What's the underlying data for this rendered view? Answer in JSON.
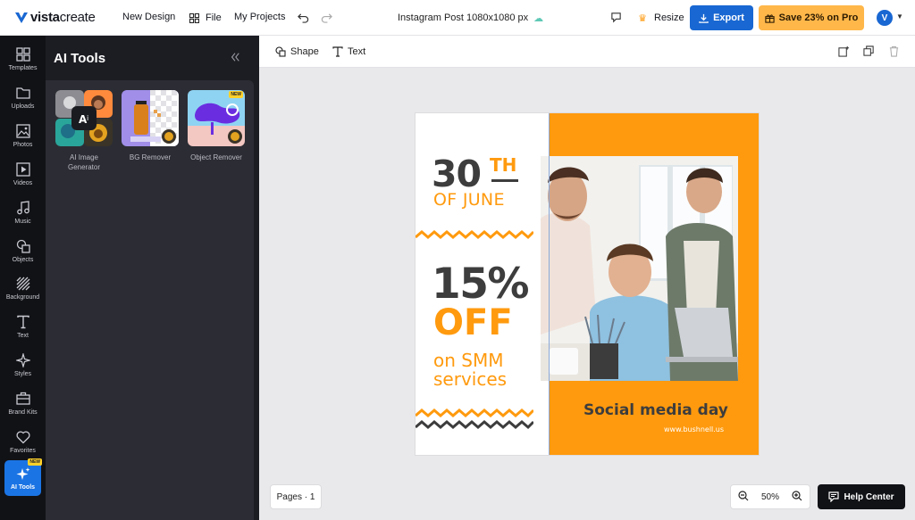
{
  "topbar": {
    "logo_bold": "vista",
    "logo_light": "create",
    "new_design": "New Design",
    "file": "File",
    "my_projects": "My Projects",
    "doc_title": "Instagram Post 1080x1080 px",
    "resize": "Resize",
    "export": "Export",
    "save_pro": "Save 23% on Pro",
    "avatar_initial": "V"
  },
  "rail": {
    "items": [
      {
        "label": "Templates",
        "icon": "templates-icon"
      },
      {
        "label": "Uploads",
        "icon": "folder-icon"
      },
      {
        "label": "Photos",
        "icon": "image-icon"
      },
      {
        "label": "Videos",
        "icon": "play-icon"
      },
      {
        "label": "Music",
        "icon": "music-note-icon"
      },
      {
        "label": "Objects",
        "icon": "shapes-icon"
      },
      {
        "label": "Background",
        "icon": "stripes-icon"
      },
      {
        "label": "Text",
        "icon": "text-t-icon"
      },
      {
        "label": "Styles",
        "icon": "sparkle-icon"
      },
      {
        "label": "Brand Kits",
        "icon": "briefcase-icon"
      },
      {
        "label": "Favorites",
        "icon": "heart-icon"
      },
      {
        "label": "AI Tools",
        "icon": "ai-sparkle-icon",
        "badge": "NEW"
      }
    ]
  },
  "panel": {
    "title": "AI Tools",
    "tools": [
      {
        "label_line1": "AI Image",
        "label_line2": "Generator"
      },
      {
        "label_line1": "BG Remover",
        "label_line2": ""
      },
      {
        "label_line1": "Object Remover",
        "label_line2": "",
        "badge": "NEW"
      }
    ]
  },
  "subbar": {
    "shape": "Shape",
    "text": "Text"
  },
  "design": {
    "day": "30",
    "suffix": "TH",
    "month": "OF JUNE",
    "percent": "15%",
    "off": "OFF",
    "service_line1": "on SMM",
    "service_line2": "services",
    "headline": "Social media day",
    "url": "www.bushnell.us",
    "colors": {
      "orange": "#ff9a0e",
      "dark": "#3d3d3d"
    }
  },
  "bottom": {
    "pages": "Pages · 1",
    "zoom": "50%",
    "help": "Help Center"
  }
}
